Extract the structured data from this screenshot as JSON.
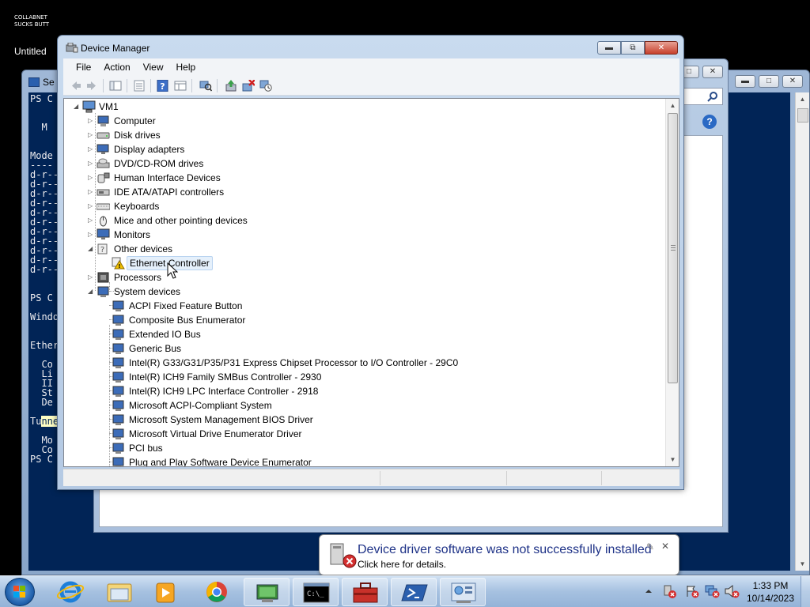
{
  "desktop": {
    "note_line1": "COLLABNET",
    "note_line2": "SUCKS BUTT",
    "untitled": "Untitled"
  },
  "powershell": {
    "title": "Se",
    "lines": [
      "PS C",
      "  M",
      "Mode",
      "----",
      "d-r--",
      "d-r--",
      "d-r--",
      "d-r--",
      "d-r--",
      "d-r--",
      "d-r--",
      "d-r--",
      "d-r--",
      "d-r--",
      "d-r--",
      "PS C",
      "Windo",
      "Ether",
      "  Co",
      "  Li",
      "  II",
      "  St",
      "  De",
      "Tu",
      "nne",
      "  Mo",
      "  Co",
      "PS C"
    ]
  },
  "device_manager": {
    "title": "Device Manager",
    "menu": [
      "File",
      "Action",
      "View",
      "Help"
    ],
    "toolbar_icons": [
      "back-icon",
      "forward-icon",
      "show-hide-tree-icon",
      "properties-icon",
      "help-icon",
      "view-icon",
      "scan-hardware-icon",
      "update-driver-icon",
      "uninstall-icon",
      "disable-icon"
    ],
    "tree": {
      "root": "VM1",
      "categories": [
        {
          "label": "Computer",
          "state": "collapsed"
        },
        {
          "label": "Disk drives",
          "state": "collapsed"
        },
        {
          "label": "Display adapters",
          "state": "collapsed"
        },
        {
          "label": "DVD/CD-ROM drives",
          "state": "collapsed"
        },
        {
          "label": "Human Interface Devices",
          "state": "collapsed"
        },
        {
          "label": "IDE ATA/ATAPI controllers",
          "state": "collapsed"
        },
        {
          "label": "Keyboards",
          "state": "collapsed"
        },
        {
          "label": "Mice and other pointing devices",
          "state": "collapsed"
        },
        {
          "label": "Monitors",
          "state": "collapsed"
        },
        {
          "label": "Other devices",
          "state": "expanded"
        },
        {
          "label": "Processors",
          "state": "collapsed"
        },
        {
          "label": "System devices",
          "state": "expanded"
        }
      ],
      "other_devices": [
        "Ethernet Controller"
      ],
      "system_devices": [
        "ACPI Fixed Feature Button",
        "Composite Bus Enumerator",
        "Extended IO Bus",
        "Generic Bus",
        "Intel(R) G33/G31/P35/P31 Express Chipset Processor to I/O Controller - 29C0",
        "Intel(R) ICH9 Family SMBus Controller - 2930",
        "Intel(R) ICH9 LPC Interface Controller - 2918",
        "Microsoft ACPI-Compliant System",
        "Microsoft System Management BIOS Driver",
        "Microsoft Virtual Drive Enumerator Driver",
        "PCI bus",
        "Plug and Play Software Device Enumerator"
      ],
      "selected": "Ethernet Controller"
    }
  },
  "notification": {
    "title": "Device driver software was not successfully installed",
    "body": "Click here for details."
  },
  "taskbar": {
    "pinned": [
      "internet-explorer-icon",
      "windows-explorer-icon",
      "media-player-icon",
      "chrome-icon",
      "computer-management-icon",
      "command-prompt-icon",
      "toolbox-icon",
      "powershell-icon",
      "control-panel-icon"
    ],
    "clock_time": "1:33 PM",
    "clock_date": "10/14/2023"
  }
}
